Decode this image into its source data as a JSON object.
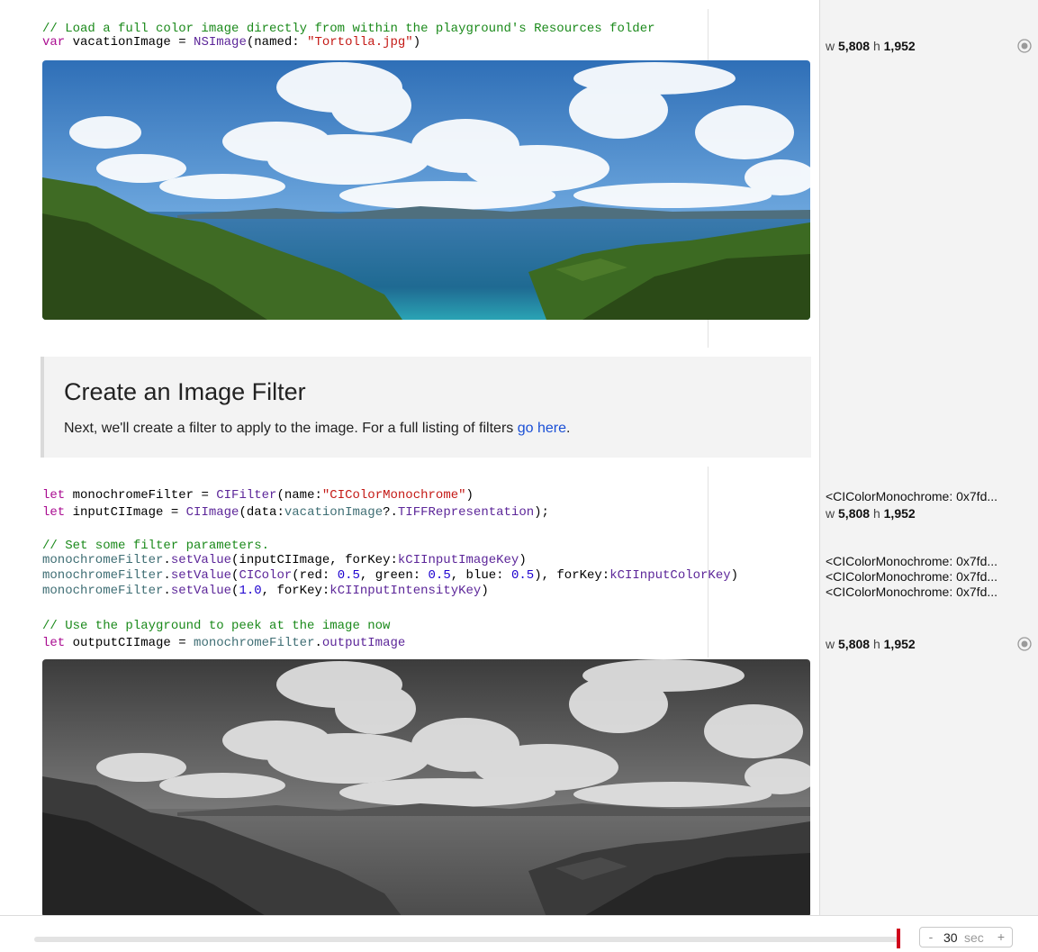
{
  "code": {
    "block1": {
      "comment": "// Load a full color image directly from within the playground's Resources folder",
      "line2": {
        "kw": "var",
        "name": " vacationImage = ",
        "type": "NSImage",
        "open": "(named: ",
        "str": "\"Tortolla.jpg\"",
        "close": ")"
      }
    },
    "block2": {
      "line1": {
        "kw": "let",
        "name": " monochromeFilter = ",
        "type": "CIFilter",
        "open": "(name:",
        "str": "\"CIColorMonochrome\"",
        "close": ")"
      },
      "line2": {
        "kw": "let",
        "name": " inputCIImage = ",
        "type": "CIImage",
        "open": "(data:",
        "var": "vacationImage",
        "mid": "?.",
        "prop": "TIFFRepresentation",
        "close": ");"
      },
      "comment1": "// Set some filter parameters.",
      "line3": {
        "obj": "monochromeFilter",
        "dot": ".",
        "fn": "setValue",
        "open": "(inputCIImage, forKey:",
        "key": "kCIInputImageKey",
        "close": ")"
      },
      "line4": {
        "obj": "monochromeFilter",
        "dot": ".",
        "fn": "setValue",
        "open": "(",
        "type": "CIColor",
        "a": "(red: ",
        "n1": "0.5",
        "b": ", green: ",
        "n2": "0.5",
        "c": ", blue: ",
        "n3": "0.5",
        "d": "), forKey:",
        "key": "kCIInputColorKey",
        "close": ")"
      },
      "line5": {
        "obj": "monochromeFilter",
        "dot": ".",
        "fn": "setValue",
        "open": "(",
        "num": "1.0",
        "mid": ", forKey:",
        "key": "kCIInputIntensityKey",
        "close": ")"
      },
      "comment2": "// Use the playground to peek at the image now",
      "line6": {
        "kw": "let",
        "name": " outputCIImage = ",
        "obj": "monochromeFilter",
        "dot": ".",
        "prop": "outputImage"
      }
    }
  },
  "doc": {
    "title": "Create an Image Filter",
    "body": "Next, we'll create a filter to apply to the image. For a full listing of filters ",
    "link": "go here",
    "end": "."
  },
  "results": {
    "r1": {
      "w": "w",
      "wv": "5,808",
      "h": "h",
      "hv": "1,952"
    },
    "r2": "<CIColorMonochrome: 0x7fd...",
    "r3": {
      "w": "w",
      "wv": "5,808",
      "h": "h",
      "hv": "1,952"
    },
    "r4": "<CIColorMonochrome: 0x7fd...",
    "r5": "<CIColorMonochrome: 0x7fd...",
    "r6": "<CIColorMonochrome: 0x7fd...",
    "r7": {
      "w": "w",
      "wv": "5,808",
      "h": "h",
      "hv": "1,952"
    }
  },
  "icons": {
    "quicklook": "eye-icon"
  },
  "timeline": {
    "minus": "-",
    "value": "30",
    "unit": "sec",
    "plus": "+"
  },
  "colors": {
    "comment": "#1b8a1b",
    "keyword": "#aa0d91",
    "string": "#c41a16",
    "type": "#5c2699",
    "number": "#1c00cf",
    "link": "#1a4fd6",
    "marker": "#d0021b"
  }
}
